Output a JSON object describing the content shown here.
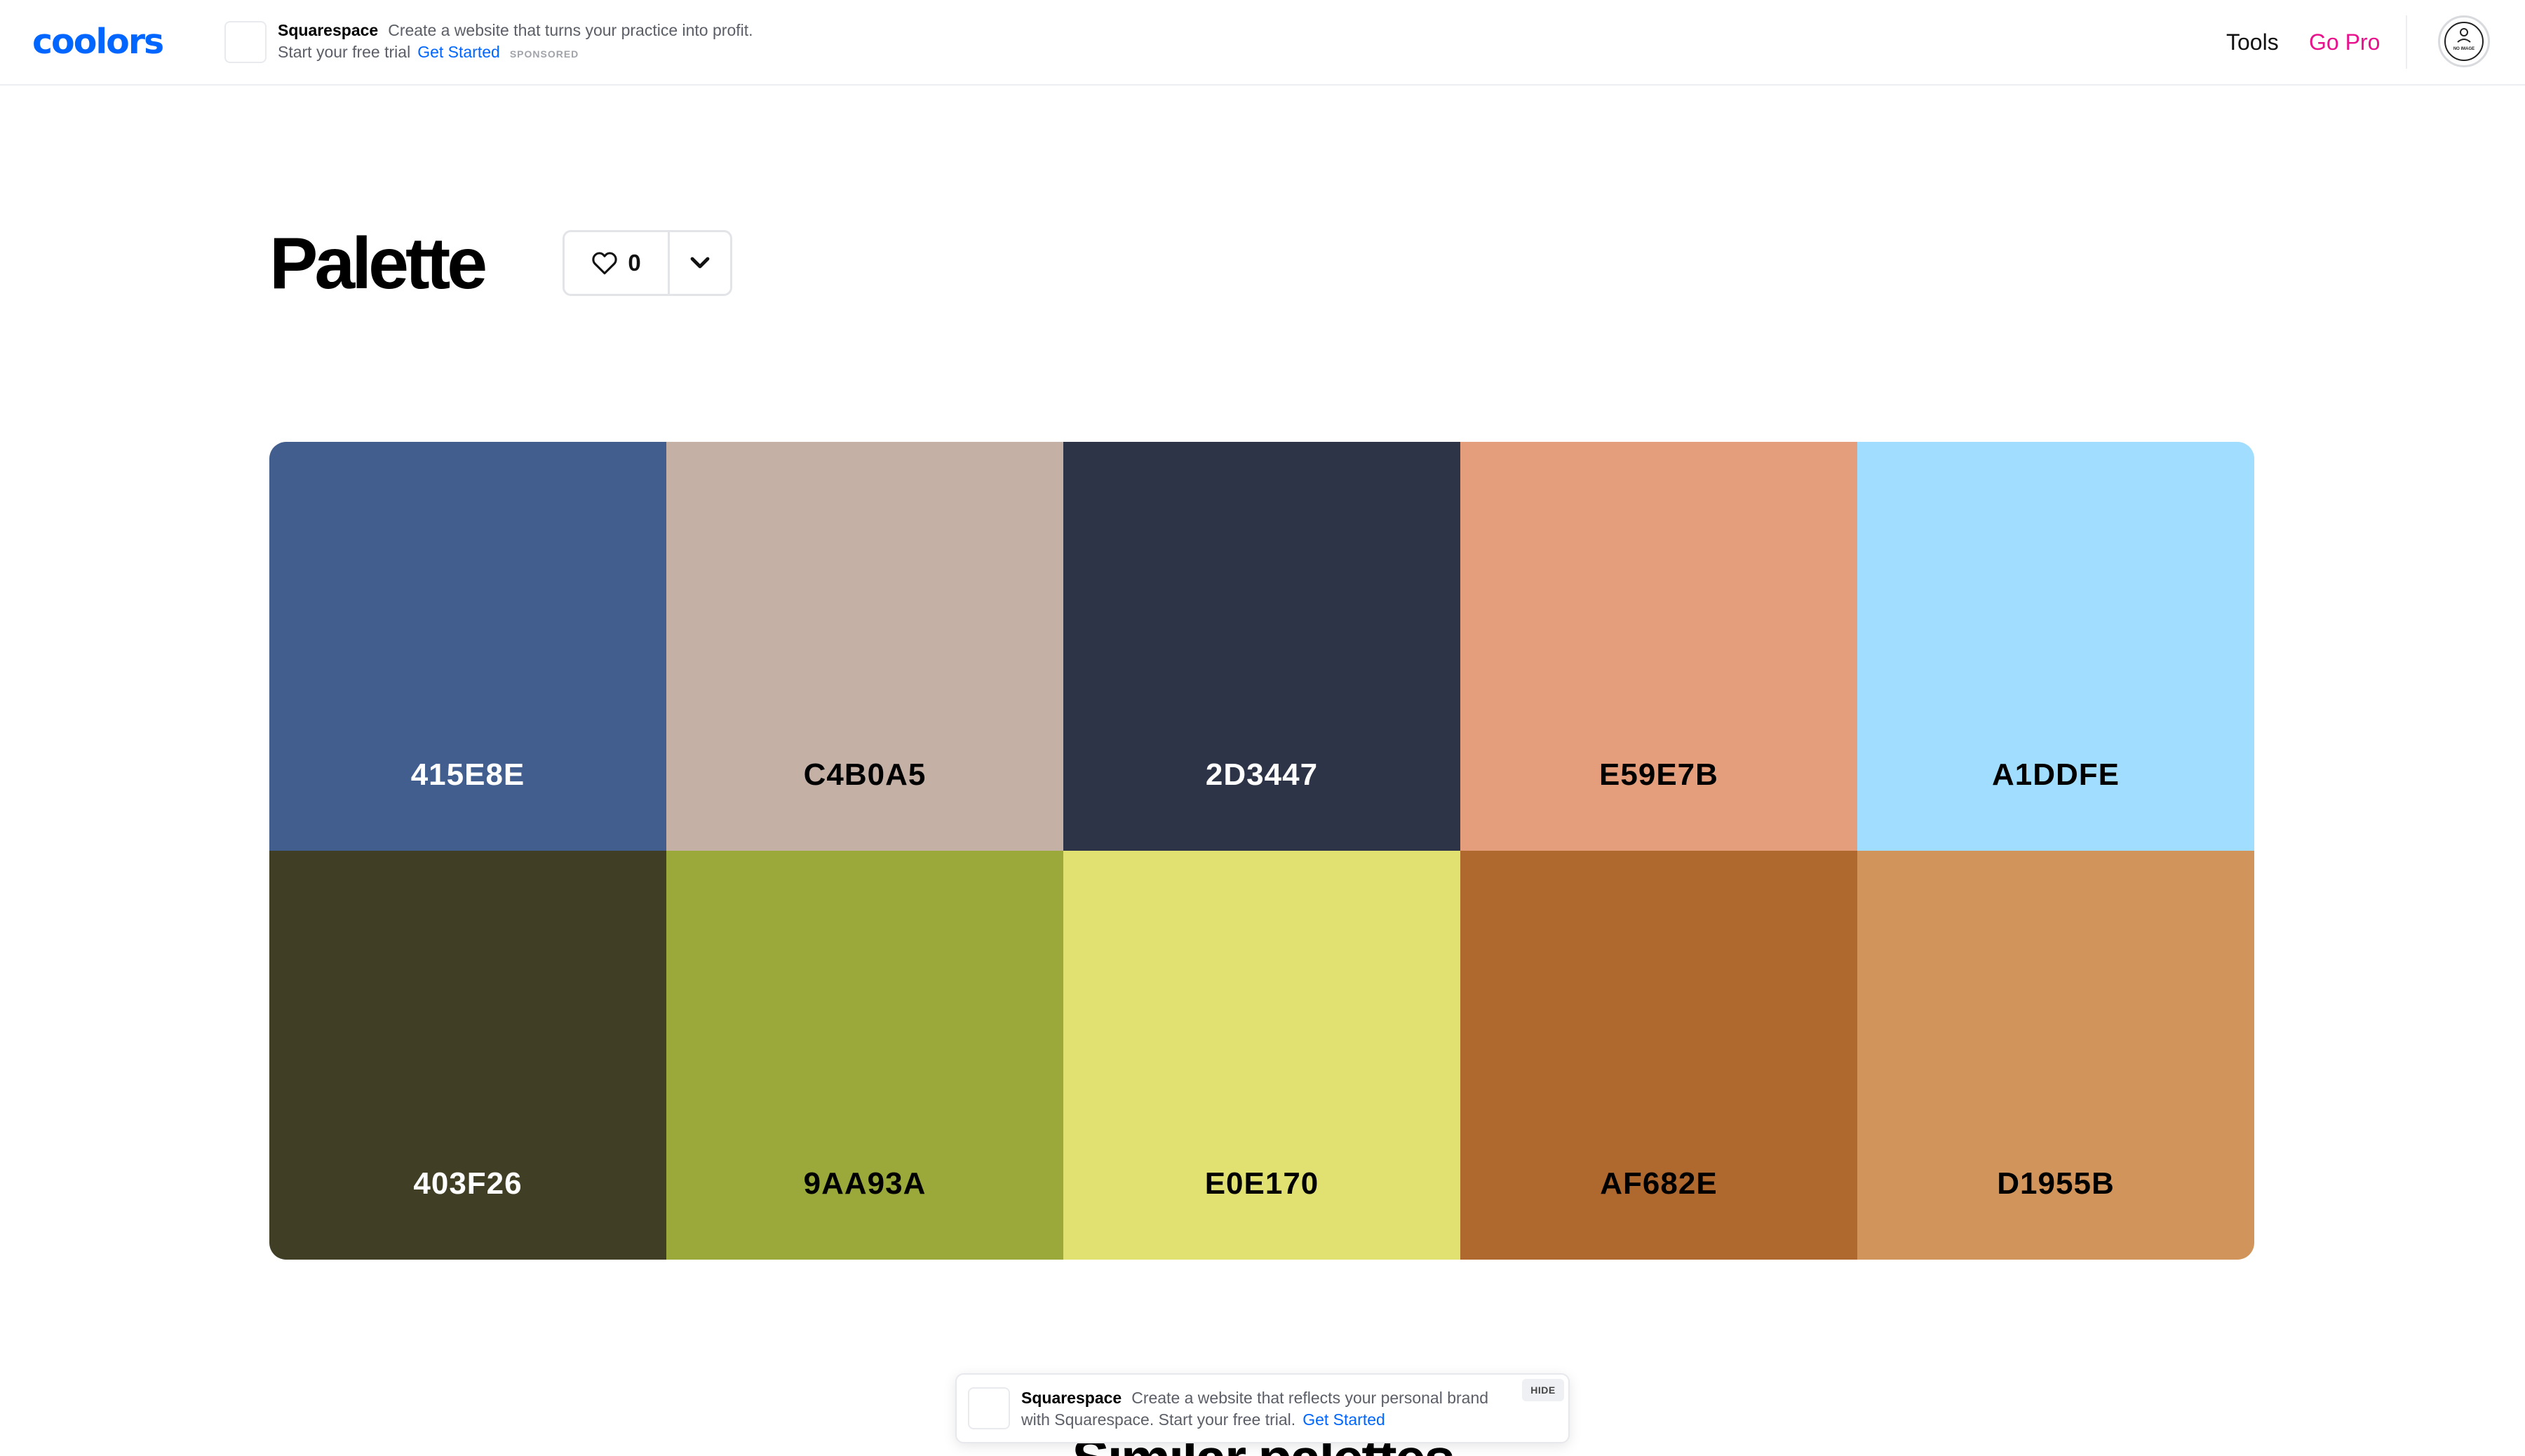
{
  "header": {
    "logo": "coolors",
    "ad": {
      "brand": "Squarespace",
      "text": "Create a website that turns your practice into profit. Start your free trial",
      "cta": "Get Started",
      "sponsored": "SPONSORED"
    },
    "nav": {
      "tools": "Tools",
      "go_pro": "Go Pro"
    },
    "avatar_text": "NO IMAGE"
  },
  "title": "Palette",
  "likes": {
    "count": "0"
  },
  "palette": {
    "colors": [
      {
        "hex": "415E8E",
        "bg": "#415E8E",
        "fg": "#ffffff"
      },
      {
        "hex": "C4B0A5",
        "bg": "#C4B0A5",
        "fg": "#000000"
      },
      {
        "hex": "2D3447",
        "bg": "#2D3447",
        "fg": "#ffffff"
      },
      {
        "hex": "E59E7B",
        "bg": "#E59E7B",
        "fg": "#000000"
      },
      {
        "hex": "A1DDFE",
        "bg": "#A1DDFE",
        "fg": "#000000"
      },
      {
        "hex": "403F26",
        "bg": "#403F26",
        "fg": "#ffffff"
      },
      {
        "hex": "9AA93A",
        "bg": "#9AA93A",
        "fg": "#000000"
      },
      {
        "hex": "E0E170",
        "bg": "#E0E170",
        "fg": "#000000"
      },
      {
        "hex": "AF682E",
        "bg": "#AF682E",
        "fg": "#000000"
      },
      {
        "hex": "D1955B",
        "bg": "#D1955B",
        "fg": "#000000"
      }
    ]
  },
  "similar": {
    "heading": "Similar palettes"
  },
  "bottom_ad": {
    "brand": "Squarespace",
    "text": "Create a website that reflects your personal brand with Squarespace. Start your free trial.",
    "cta": "Get Started",
    "hide": "HIDE"
  },
  "colors": {
    "accent": "#0066ff",
    "go_pro": "#e8128c"
  }
}
